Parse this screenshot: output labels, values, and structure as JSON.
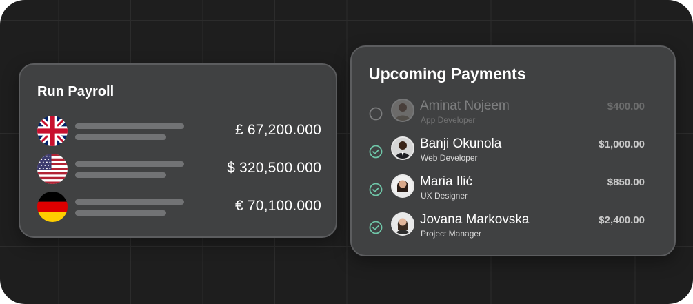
{
  "payroll": {
    "title": "Run Payroll",
    "rows": [
      {
        "flag_icon": "uk-flag-icon",
        "amount": "£  67,200.000"
      },
      {
        "flag_icon": "us-flag-icon",
        "amount": "$ 320,500.000"
      },
      {
        "flag_icon": "germany-flag-icon",
        "amount": "€ 70,100.000"
      }
    ]
  },
  "upcoming": {
    "title": "Upcoming Payments",
    "payments": [
      {
        "name": "Aminat Nojeem",
        "role": "App Developer",
        "amount": "$400.00",
        "status": "pending"
      },
      {
        "name": "Banji Okunola",
        "role": "Web Developer",
        "amount": "$1,000.00",
        "status": "done"
      },
      {
        "name": "Maria Ilić",
        "role": "UX Designer",
        "amount": "$850.00",
        "status": "done"
      },
      {
        "name": "Jovana Markovska",
        "role": "Project Manager",
        "amount": "$2,400.00",
        "status": "done"
      }
    ]
  },
  "colors": {
    "background": "#1e1e1e",
    "card": "#404142",
    "check_accent": "#6fc6a8",
    "placeholder_bar": "#727375"
  }
}
